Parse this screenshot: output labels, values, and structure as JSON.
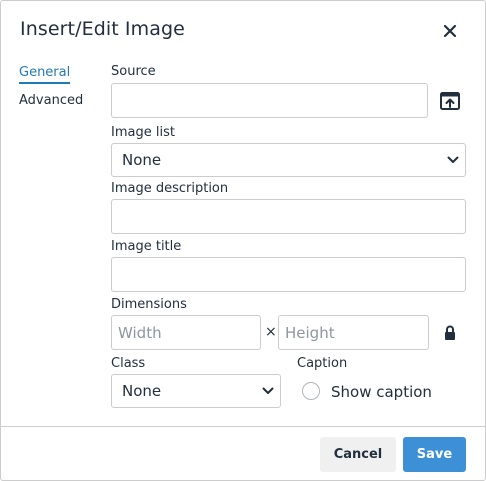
{
  "dialog": {
    "title": "Insert/Edit Image"
  },
  "tabs": [
    {
      "label": "General",
      "active": true
    },
    {
      "label": "Advanced",
      "active": false
    }
  ],
  "fields": {
    "source": {
      "label": "Source",
      "value": ""
    },
    "image_list": {
      "label": "Image list",
      "selected": "None"
    },
    "image_description": {
      "label": "Image description",
      "value": ""
    },
    "image_title": {
      "label": "Image title",
      "value": ""
    },
    "dimensions": {
      "label": "Dimensions",
      "width_placeholder": "Width",
      "height_placeholder": "Height",
      "separator": "×"
    },
    "class": {
      "label": "Class",
      "selected": "None"
    },
    "caption": {
      "label": "Caption",
      "checkbox_label": "Show caption",
      "checked": false
    }
  },
  "buttons": {
    "cancel": "Cancel",
    "save": "Save"
  },
  "colors": {
    "accent": "#207ab7",
    "primary_button": "#3d8fd6",
    "text": "#222f3e",
    "border": "#cccccc"
  },
  "icons": {
    "close": "close-icon",
    "browse": "browse-upload-icon",
    "lock": "lock-icon",
    "chevron": "chevron-down-icon"
  }
}
